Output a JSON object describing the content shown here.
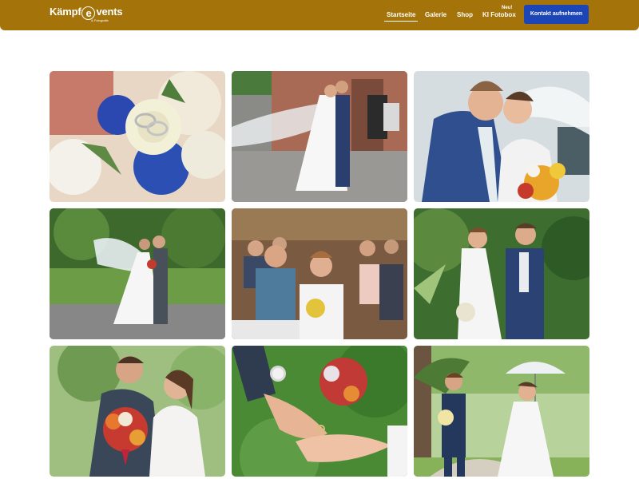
{
  "header": {
    "logo": {
      "brand_before": "Kämpf",
      "brand_e": "e",
      "brand_after": "vents",
      "tagline": "& Fotografie"
    },
    "nav": [
      {
        "label": "Startseite",
        "active": true
      },
      {
        "label": "Galerie",
        "active": false
      },
      {
        "label": "Shop",
        "active": false
      },
      {
        "label": "KI Fotobox",
        "active": false
      }
    ],
    "new_badge": "Neu!",
    "cta_label": "Kontakt aufnehmen",
    "bar_color": "#a4740a",
    "cta_color": "#1c46b8"
  },
  "gallery": {
    "photos": [
      {
        "subject": "wedding rings on white rose and blue flower bouquet"
      },
      {
        "subject": "couple kissing with flowing veil by historic building"
      },
      {
        "subject": "groom kissing bride with sunflower bouquet"
      },
      {
        "subject": "couple on park path with windblown veil"
      },
      {
        "subject": "smiling couple in church with guests"
      },
      {
        "subject": "couple walking hand in hand in garden"
      },
      {
        "subject": "groom and bride with red and orange bouquet"
      },
      {
        "subject": "close-up of hands with rings and watch"
      },
      {
        "subject": "couple running with umbrella on garden path"
      }
    ]
  }
}
